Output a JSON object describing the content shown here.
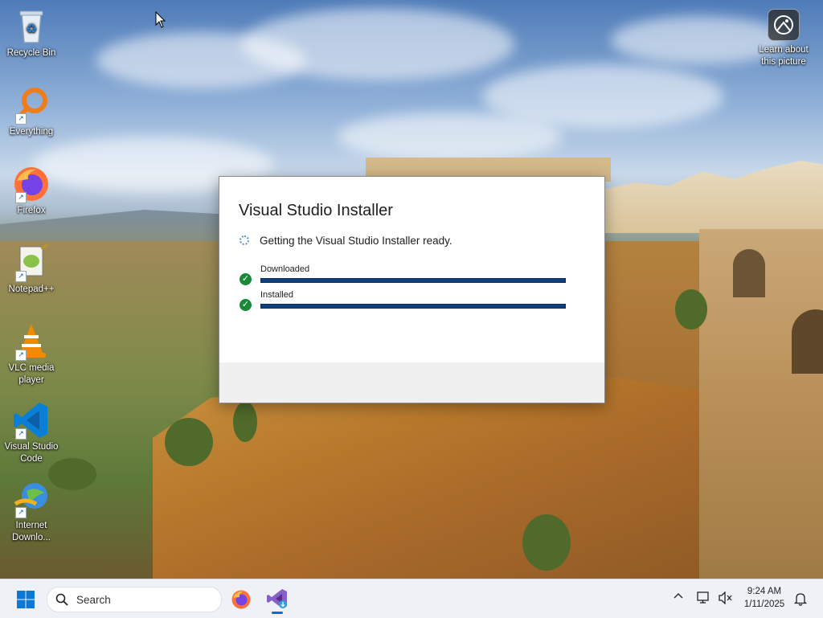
{
  "desktop": {
    "icons": [
      {
        "label": "Recycle Bin",
        "icon": "recycle-bin-icon"
      },
      {
        "label": "Everything",
        "icon": "everything-search-icon"
      },
      {
        "label": "Firefox",
        "icon": "firefox-icon"
      },
      {
        "label": "Notepad++",
        "icon": "notepad-plus-plus-icon"
      },
      {
        "label": "VLC media player",
        "icon": "vlc-icon"
      },
      {
        "label": "Visual Studio Code",
        "icon": "vscode-icon"
      },
      {
        "label": "Internet Downlo...",
        "icon": "internet-download-manager-icon"
      }
    ],
    "learn_about_picture": "Learn about this picture"
  },
  "installer": {
    "title": "Visual Studio Installer",
    "status": "Getting the Visual Studio Installer ready.",
    "steps": [
      {
        "label": "Downloaded",
        "progress": 1.0
      },
      {
        "label": "Installed",
        "progress": 1.0
      }
    ],
    "accent_color": "#0e3f7a",
    "check_color": "#1a8a3a"
  },
  "taskbar": {
    "search_placeholder": "Search",
    "apps": [
      "firefox-icon",
      "visual-studio-installer-icon"
    ],
    "time": "9:24 AM",
    "date": "1/11/2025"
  }
}
